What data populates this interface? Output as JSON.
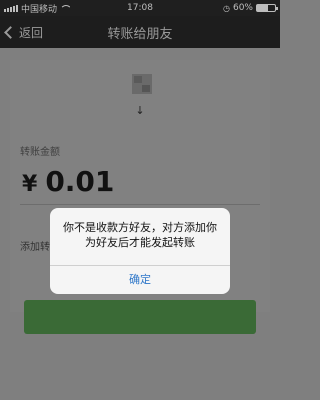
{
  "status_bar": {
    "carrier": "中国移动",
    "time": "17:08",
    "battery_percent": "60%",
    "battery_level": 0.6
  },
  "nav": {
    "back_label": "返回",
    "title": "转账给朋友"
  },
  "recipient": {
    "nickname": "↓"
  },
  "amount_section": {
    "label": "转账金额",
    "currency_symbol": "¥",
    "value": "0.01"
  },
  "note_link": "添加转",
  "dialog": {
    "message": "你不是收款方好友，对方添加你为好友后才能发起转账",
    "confirm_label": "确定"
  },
  "colors": {
    "dialog_button": "#2e77c9",
    "transfer_button": "#3a6a36"
  }
}
